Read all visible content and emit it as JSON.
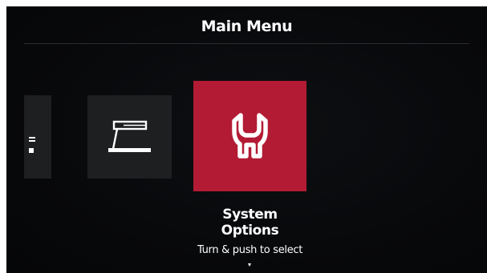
{
  "header": {
    "title": "Main Menu"
  },
  "menu": {
    "items": [
      {
        "name": "previous-item-partial",
        "icon": "list-icon",
        "selected": false
      },
      {
        "name": "table-tool-item",
        "icon": "table-tool-icon",
        "selected": false
      },
      {
        "name": "system-options-item",
        "icon": "wrench-icon",
        "selected": true
      }
    ],
    "selected_label": "System Options"
  },
  "hint": {
    "text": "Turn & push to select",
    "icon": "chevron-down-icon"
  },
  "colors": {
    "background": "#08090b",
    "tile": "#1d1f21",
    "accent": "#b31b34",
    "text": "#ffffff"
  }
}
